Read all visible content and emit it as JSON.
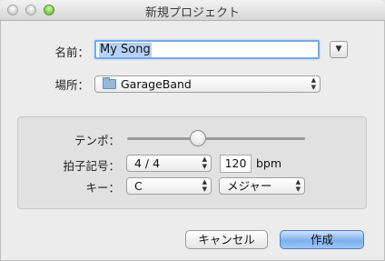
{
  "window": {
    "title": "新規プロジェクト"
  },
  "form": {
    "name_label": "名前：",
    "name_value": "My Song",
    "location_label": "場所：",
    "location_value": "GarageBand"
  },
  "settings": {
    "tempo_label": "テンポ：",
    "tempo_slider_fraction": 0.4,
    "time_signature_label": "拍子記号：",
    "time_signature_value": "4 / 4",
    "bpm_value": "120",
    "bpm_unit": "bpm",
    "key_label": "キー：",
    "key_value": "C",
    "scale_value": "メジャー"
  },
  "buttons": {
    "cancel": "キャンセル",
    "create": "作成"
  },
  "icons": {
    "disclosure": "chevron-down-icon",
    "folder": "folder-icon",
    "popup_arrows": "updown-arrows-icon"
  },
  "colors": {
    "accent": "#77a9e6",
    "selection": "#b6d1f4",
    "default_button": "#7fb1ef"
  }
}
